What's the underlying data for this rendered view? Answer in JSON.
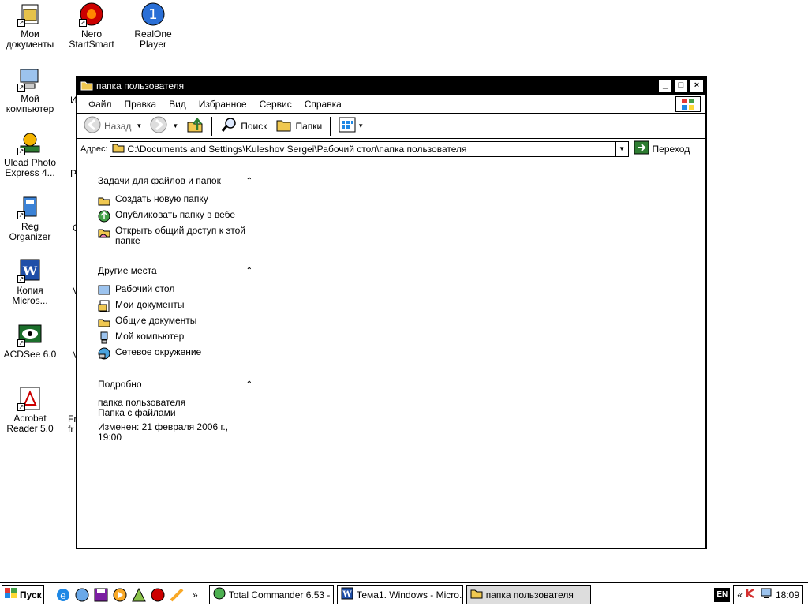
{
  "desktop": {
    "icons": [
      {
        "label": "Мои документы",
        "icon": "my-documents-icon"
      },
      {
        "label": "Nero StartSmart",
        "icon": "nero-icon"
      },
      {
        "label": "RealOne Player",
        "icon": "realone-icon"
      },
      {
        "label": "Мой компьютер",
        "icon": "my-computer-icon"
      },
      {
        "label": "Ulead Photo Express 4...",
        "icon": "ulead-icon"
      },
      {
        "label": "Reg Organizer",
        "icon": "reg-organizer-icon"
      },
      {
        "label": "Копия Micros...",
        "icon": "word-icon"
      },
      {
        "label": "ACDSee 6.0",
        "icon": "acdsee-icon"
      },
      {
        "label": "Acrobat Reader 5.0",
        "icon": "acrobat-icon"
      }
    ],
    "partial_labels": [
      "И",
      "Р",
      "О",
      "М",
      "М",
      "Fr",
      "fr"
    ]
  },
  "window": {
    "title": "папка пользователя",
    "controls": {
      "minimize": "_",
      "maximize": "□",
      "close": "×"
    },
    "menu": [
      "Файл",
      "Правка",
      "Вид",
      "Избранное",
      "Сервис",
      "Справка"
    ],
    "toolbar": {
      "back": "Назад",
      "search": "Поиск",
      "folders": "Папки"
    },
    "address": {
      "label": "Адрес:",
      "value": "C:\\Documents and Settings\\Kuleshov Sergei\\Рабочий стол\\папка пользователя",
      "go": "Переход"
    }
  },
  "taskpane": {
    "tasks": {
      "title": "Задачи для файлов и папок",
      "items": [
        "Создать новую папку",
        "Опубликовать папку в вебе",
        "Открыть общий доступ к этой папке"
      ]
    },
    "places": {
      "title": "Другие места",
      "items": [
        "Рабочий стол",
        "Мои документы",
        "Общие документы",
        "Мой компьютер",
        "Сетевое окружение"
      ]
    },
    "details": {
      "title": "Подробно",
      "name": "папка пользователя",
      "type": "Папка с файлами",
      "modified": "Изменен: 21 февраля 2006 г., 19:00"
    }
  },
  "taskbar": {
    "start": "Пуск",
    "more": "»",
    "tasks": [
      {
        "label": "Total Commander 6.53 - ...",
        "active": false
      },
      {
        "label": "Тема1. Windows - Micro...",
        "active": false
      },
      {
        "label": "папка пользователя",
        "active": true
      }
    ],
    "lang": "EN",
    "tray_chevron": "«",
    "time": "18:09"
  }
}
